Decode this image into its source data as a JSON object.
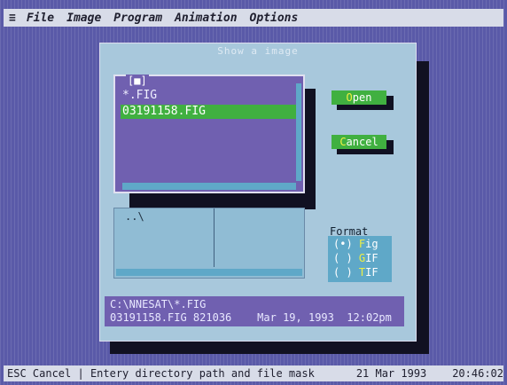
{
  "menubar": {
    "system_icon": "≡",
    "items": [
      "File",
      "Image",
      "Program",
      "Animation",
      "Options"
    ]
  },
  "dialog": {
    "title": "Show a image",
    "list_header": "[■]",
    "list_items": [
      "*.FIG",
      "03191158.FIG"
    ],
    "selected_index": 1,
    "tree_root": "..\\",
    "open_hot": "O",
    "open_rest": "pen",
    "cancel_hot": "C",
    "cancel_rest": "ancel",
    "format_label": "Format",
    "format_options": [
      {
        "mark": "(•)",
        "hot": "F",
        "rest": "ig"
      },
      {
        "mark": "( )",
        "hot": "G",
        "rest": "IF"
      },
      {
        "mark": "( )",
        "hot": "T",
        "rest": "IF"
      }
    ],
    "path": "C:\\NNESAT\\*.FIG",
    "file_info": "03191158.FIG 821036    Mar 19, 1993  12:02pm"
  },
  "status": {
    "esc": "ESC Cancel",
    "hint": "Entery directory path and file mask",
    "date": "21 Mar 1993",
    "time": "20:46:02"
  },
  "colors": {
    "desktop": "#5a5aa8",
    "dialog": "#a8c8dc",
    "list": "#7060b0",
    "button": "#40b040",
    "hotkey": "#f0f040"
  }
}
